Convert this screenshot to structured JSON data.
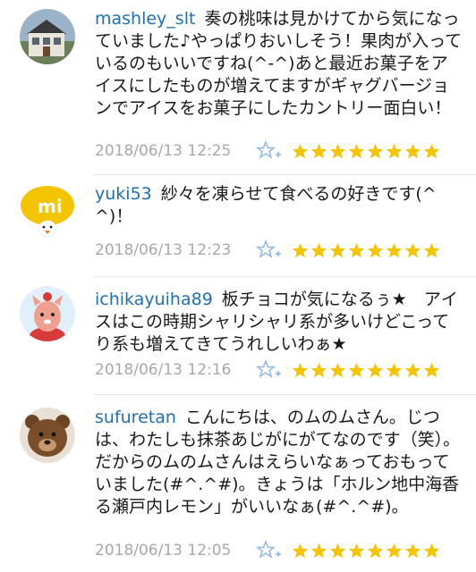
{
  "comments": [
    {
      "username": "mashley_slt",
      "text": "奏の桃味は見かけてから気になっていました♪やっぱりおいしそう！果肉が入っているのもいいですね(^-^)あと最近お菓子をアイスにしたものが増えてますがギャグバージョンでアイスをお菓子にしたカントリー面白い！",
      "timestamp": "2018/06/13 12:25",
      "star_count": 8
    },
    {
      "username": "yuki53",
      "text": "紗々を凍らせて食べるの好きです(^^)！",
      "timestamp": "2018/06/13 12:23",
      "star_count": 8
    },
    {
      "username": "ichikayuiha89",
      "text": "板チョコが気になるぅ★　アイスはこの時期シャリシャリ系が多いけどこってり系も増えてきてうれしいわぁ★",
      "timestamp": "2018/06/13 12:16",
      "star_count": 8
    },
    {
      "username": "sufuretan",
      "text": "こんにちは、のムのムさん。じつは、わたしも抹茶あじがにがてなのです（笑）。だからのムのムさんはえらいなぁっておもっていました(#^.^#)。きょうは「ホルン地中海香る瀬戸内レモン」がいいなぁ(#^.^#)。",
      "timestamp": "2018/06/13 12:05",
      "star_count": 8
    }
  ],
  "colors": {
    "username": "#1f6fb5",
    "timestamp": "#a8a8a8",
    "star_fill": "#f5c400",
    "fav_icon": "#8fb8e8"
  },
  "icons": {
    "add_favorite": "star-plus-icon",
    "rating": "star-icon"
  }
}
